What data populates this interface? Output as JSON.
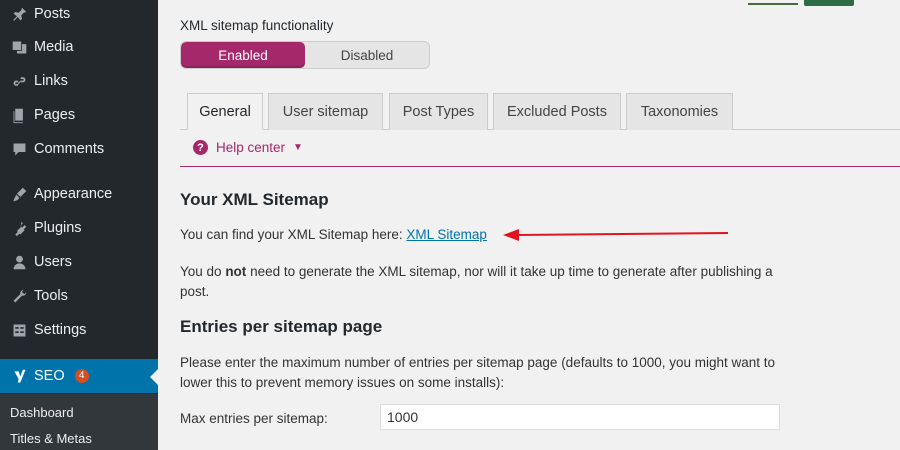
{
  "sidebar": {
    "items": [
      {
        "label": "Posts",
        "icon": "pin-icon"
      },
      {
        "label": "Media",
        "icon": "media-icon"
      },
      {
        "label": "Links",
        "icon": "link-icon"
      },
      {
        "label": "Pages",
        "icon": "pages-icon"
      },
      {
        "label": "Comments",
        "icon": "comment-icon"
      },
      {
        "label": "Appearance",
        "icon": "brush-icon"
      },
      {
        "label": "Plugins",
        "icon": "plug-icon"
      },
      {
        "label": "Users",
        "icon": "user-icon"
      },
      {
        "label": "Tools",
        "icon": "wrench-icon"
      },
      {
        "label": "Settings",
        "icon": "settings-icon"
      }
    ],
    "seo": {
      "label": "SEO",
      "badge": "4",
      "icon": "yoast-icon"
    },
    "submenu": [
      {
        "label": "Dashboard"
      },
      {
        "label": "Titles & Metas"
      }
    ]
  },
  "main": {
    "functionality_label": "XML sitemap functionality",
    "toggle": {
      "enabled": "Enabled",
      "disabled": "Disabled",
      "selected": "Enabled"
    },
    "tabs": [
      {
        "label": "General",
        "active": true
      },
      {
        "label": "User sitemap"
      },
      {
        "label": "Post Types"
      },
      {
        "label": "Excluded Posts"
      },
      {
        "label": "Taxonomies"
      }
    ],
    "help_center": "Help center",
    "sitemap_heading": "Your XML Sitemap",
    "find_text": "You can find your XML Sitemap here:",
    "sitemap_link": "XML Sitemap",
    "no_need_1": "You do ",
    "no_need_bold": "not",
    "no_need_2": " need to generate the XML sitemap, nor will it take up time to generate after publishing a post.",
    "entries_heading": "Entries per sitemap page",
    "entries_desc": "Please enter the maximum number of entries per sitemap page (defaults to 1000, you might want to lower this to prevent memory issues on some installs):",
    "max_entries_label": "Max entries per sitemap:",
    "max_entries_value": "1000"
  },
  "colors": {
    "sidebar_bg": "#23282d",
    "seo_active": "#0073aa",
    "accent": "#a4286a",
    "arrow": "#e0141e",
    "link": "#0073aa"
  }
}
